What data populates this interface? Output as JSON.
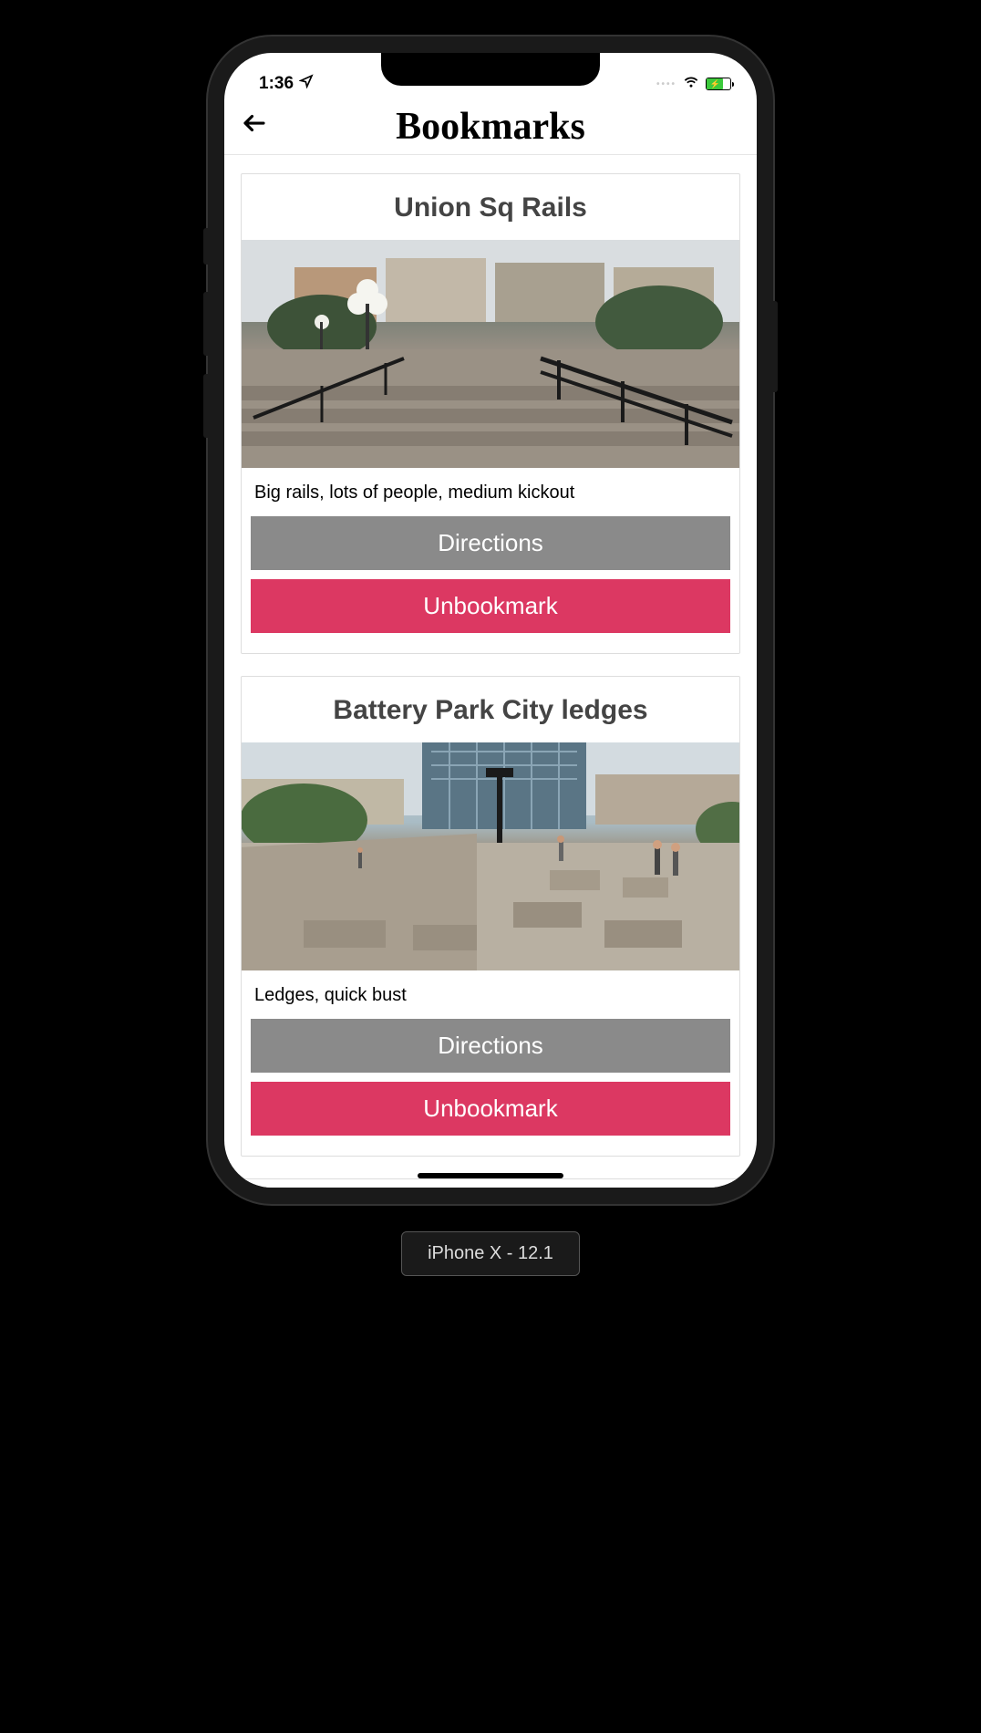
{
  "status_bar": {
    "time": "1:36",
    "location_icon": "location-arrow",
    "cellular_icon": "dots",
    "wifi_icon": "wifi",
    "battery_icon": "battery-charging"
  },
  "nav": {
    "back_icon": "arrow-left",
    "title": "Bookmarks"
  },
  "cards": [
    {
      "title": "Union Sq Rails",
      "image_alt": "Union Square plaza with rails and steps",
      "description": "Big rails, lots of people, medium kickout",
      "directions_label": "Directions",
      "unbookmark_label": "Unbookmark"
    },
    {
      "title": "Battery Park City ledges",
      "image_alt": "Battery Park City plaza with stone ledges",
      "description": "Ledges, quick bust",
      "directions_label": "Directions",
      "unbookmark_label": "Unbookmark"
    }
  ],
  "device_label": "iPhone X - 12.1",
  "colors": {
    "btn_gray": "#8a8a8a",
    "btn_pink": "#dc3862",
    "battery_green": "#3cc93c"
  }
}
